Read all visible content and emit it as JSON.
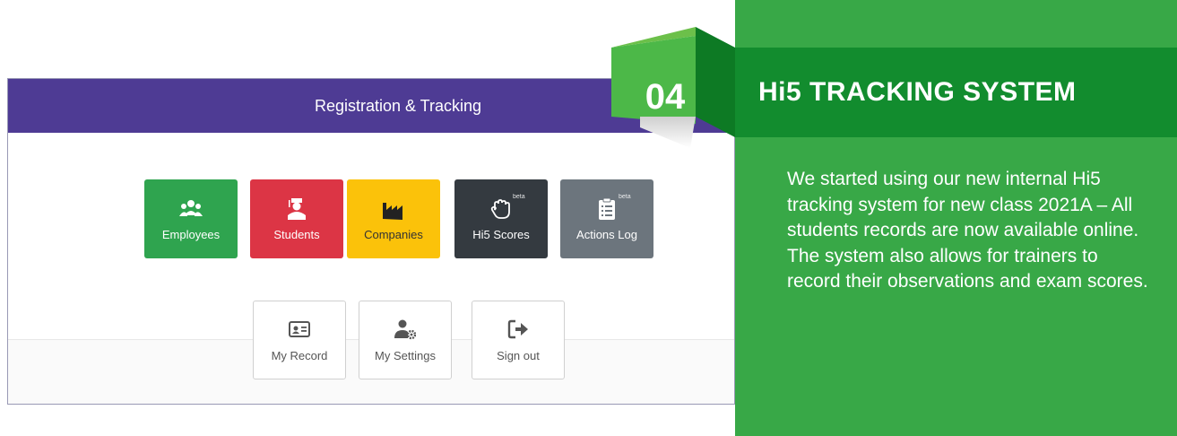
{
  "app": {
    "header_title": "Registration & Tracking",
    "tiles": [
      {
        "label": "Employees",
        "icon": "users-icon",
        "color": "#2fa44f"
      },
      {
        "label": "Students",
        "icon": "graduate-icon",
        "color": "#dc3545"
      },
      {
        "label": "Companies",
        "icon": "factory-icon",
        "color": "#fbc20a"
      },
      {
        "label": "Hi5 Scores",
        "icon": "hand-icon",
        "color": "#343a40",
        "badge": "beta"
      },
      {
        "label": "Actions Log",
        "icon": "clipboard-list-icon",
        "color": "#6c757d",
        "badge": "beta"
      }
    ],
    "user_buttons": [
      {
        "label": "My Record",
        "icon": "id-card-icon"
      },
      {
        "label": "My Settings",
        "icon": "user-gear-icon"
      },
      {
        "label": "Sign out",
        "icon": "sign-out-icon"
      }
    ]
  },
  "panel": {
    "number": "04",
    "title": "Hi5 TRACKING SYSTEM",
    "body": "We started using our new internal Hi5 tracking system for new class 2021A – All students records are now available online. The system also allows for trainers to record their observations and exam scores.",
    "accent": "#38a847",
    "band_color": "#128c2e"
  }
}
